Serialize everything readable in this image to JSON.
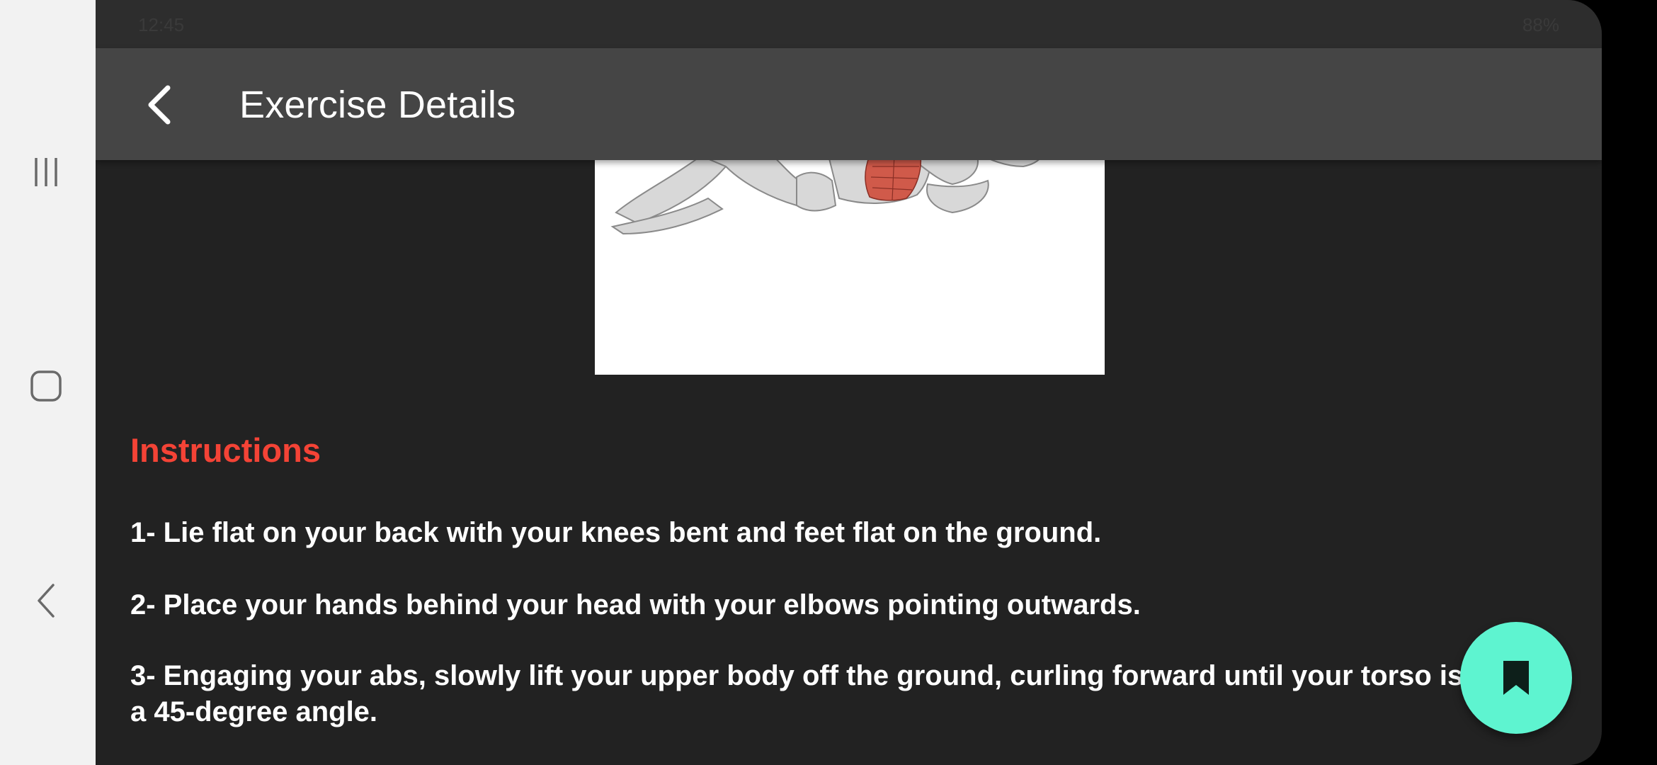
{
  "status_bar": {
    "time": "12:45",
    "right": "88%"
  },
  "nav_rail": {
    "recents_icon": "recents-icon",
    "home_icon": "home-icon",
    "back_icon": "back-icon"
  },
  "app_bar": {
    "title": "Exercise Details",
    "back_icon": "chevron-left-icon"
  },
  "image": {
    "description_icon": "exercise-illustration"
  },
  "instructions": {
    "heading": "Instructions",
    "steps": [
      "1- Lie flat on your back with your knees bent and feet flat on the ground.",
      "2- Place your hands behind your head with your elbows pointing outwards.",
      "3- Engaging your abs, slowly lift your upper body off the ground, curling forward until your torso is at a 45-degree angle."
    ]
  },
  "fab": {
    "icon": "bookmark-icon"
  },
  "colors": {
    "background": "#222222",
    "app_bar": "#454545",
    "accent_heading": "#f44336",
    "fab": "#5ef4d0",
    "text": "#ffffff"
  }
}
